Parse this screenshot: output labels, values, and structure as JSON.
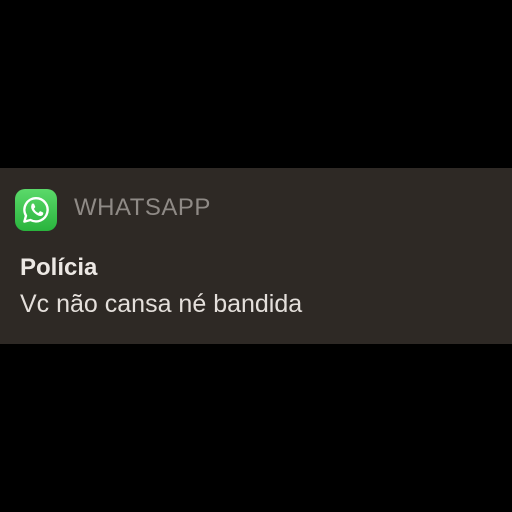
{
  "notification": {
    "app_name": "WHATSAPP",
    "app_icon": "whatsapp-icon",
    "sender": "Polícia",
    "message": "Vc não cansa né bandida"
  },
  "colors": {
    "background": "#000000",
    "notification_background": "#2e2925",
    "icon_green": "#3cc24f",
    "app_name_text": "#8f8a86",
    "primary_text": "#ece8e4"
  }
}
